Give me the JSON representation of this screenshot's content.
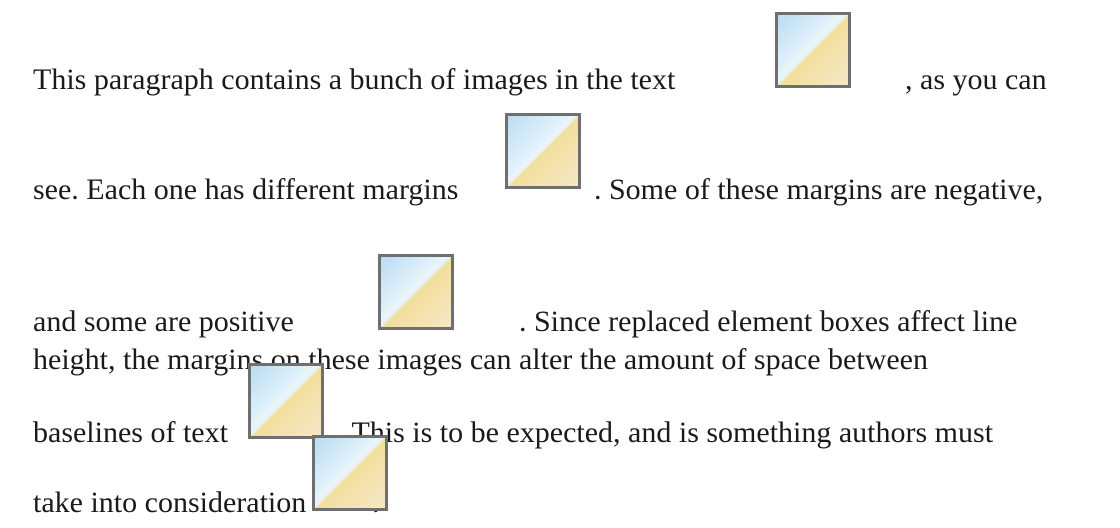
{
  "paragraph": {
    "line1_a": "This paragraph contains a bunch of images in the text",
    "line1_b": ", as you can",
    "line2_a": "see. Each one has different margins",
    "line2_b": ". Some of these margins are negative,",
    "line3_a": "and some are positive",
    "line3_b": ". Since replaced element boxes affect line",
    "line4": "height, the margins on these images can alter the amount of space between",
    "line5_a": "baselines of text",
    "line5_b": ". This is to be expected, and is something authors must",
    "line6_a": "take into consideration",
    "line6_b": "."
  },
  "images": [
    {
      "name": "inline-image-1",
      "icon": "gradient-square-image"
    },
    {
      "name": "inline-image-2",
      "icon": "gradient-square-image"
    },
    {
      "name": "inline-image-3",
      "icon": "gradient-square-image"
    },
    {
      "name": "inline-image-4",
      "icon": "gradient-square-image"
    },
    {
      "name": "inline-image-5",
      "icon": "gradient-square-image"
    }
  ]
}
